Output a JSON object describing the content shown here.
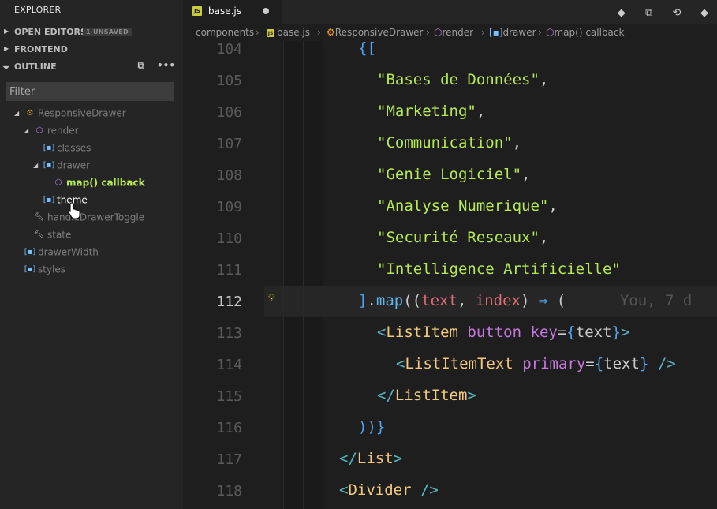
{
  "sidebar": {
    "title": "EXPLORER",
    "open_editors": {
      "label": "OPEN EDITORS",
      "badge": "1 UNSAVED"
    },
    "frontend": {
      "label": "FRONTEND"
    },
    "outline": {
      "label": "OUTLINE",
      "collapse_icon": "collapse-all-icon",
      "more_icon": "ellipsis-icon"
    },
    "filter_placeholder": "Filter",
    "tree": [
      {
        "label": "ResponsiveDrawer",
        "icon": "class-icon"
      },
      {
        "label": "render",
        "icon": "method-icon"
      },
      {
        "label": "classes",
        "icon": "variable-icon"
      },
      {
        "label": "drawer",
        "icon": "variable-icon"
      },
      {
        "label": "map() callback",
        "icon": "method-icon"
      },
      {
        "label": "theme",
        "icon": "variable-icon"
      },
      {
        "label": "handleDrawerToggle",
        "icon": "property-icon"
      },
      {
        "label": "state",
        "icon": "property-icon"
      },
      {
        "label": "drawerWidth",
        "icon": "variable-icon"
      },
      {
        "label": "styles",
        "icon": "variable-icon"
      }
    ]
  },
  "tabs": [
    {
      "label": "base.js",
      "dirty": true
    }
  ],
  "top_actions": [
    "git-compare-icon",
    "live-share-icon",
    "go-to-changes-icon",
    "git-icon"
  ],
  "breadcrumb": [
    "components",
    "base.js",
    "ResponsiveDrawer",
    "render",
    "drawer",
    "map() callback"
  ],
  "editor": {
    "line_numbers": [
      "104",
      "105",
      "106",
      "107",
      "108",
      "109",
      "110",
      "111",
      "112",
      "113",
      "114",
      "115",
      "116",
      "117",
      "118"
    ],
    "active_line": "112",
    "blame": "You, 7 d",
    "strings": [
      "\"Bases de Données\"",
      "\"Marketing\"",
      "\"Communication\"",
      "\"Genie Logiciel\"",
      "\"Analyse Numerique\"",
      "\"Securité Reseaux\"",
      "\"Intelligence Artificielle\""
    ]
  },
  "colors": {
    "sidebar_bg": "#252526",
    "editor_bg": "#1e1e1e",
    "string": "#b5e853",
    "selected_outline": "#b5e853"
  }
}
